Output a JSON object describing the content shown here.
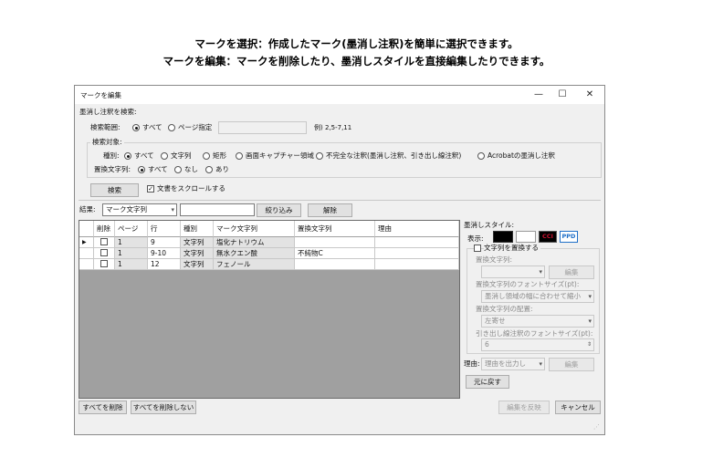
{
  "captions": [
    "マークを選択：作成したマーク(墨消し注釈)を簡単に選択できます。",
    "マークを編集：マークを削除したり、墨消しスタイルを直接編集したりできます。"
  ],
  "window": {
    "title": "マークを編集",
    "controls": {
      "minimize": "—",
      "maximize": "☐",
      "close": "✕"
    }
  },
  "search": {
    "section_label": "墨消し注釈を検索:",
    "range_label": "検索範囲:",
    "range_all": "すべて",
    "range_pages": "ページ指定",
    "range_input_value": "",
    "range_example": "例) 2,5-7,11",
    "target_label": "検索対象:",
    "type_label": "種別:",
    "types": [
      {
        "label": "すべて",
        "selected": true
      },
      {
        "label": "文字列",
        "selected": false
      },
      {
        "label": "矩形",
        "selected": false
      },
      {
        "label": "画面キャプチャー領域",
        "selected": false
      },
      {
        "label": "不完全な注釈(墨消し注釈、引き出し線注釈)",
        "selected": false
      },
      {
        "label": "Acrobatの墨消し注釈",
        "selected": false
      }
    ],
    "replace_label": "置換文字列:",
    "replace_options": [
      {
        "label": "すべて",
        "selected": true
      },
      {
        "label": "なし",
        "selected": false
      },
      {
        "label": "あり",
        "selected": false
      }
    ],
    "search_button": "検索",
    "scroll_checkbox": "文書をスクロールする",
    "scroll_checked": true
  },
  "results": {
    "label": "結果:",
    "filter_field": "マーク文字列",
    "filter_value": "",
    "narrow_button": "絞り込み",
    "clear_button": "解除",
    "columns": [
      "削除",
      "ページ",
      "行",
      "種別",
      "マーク文字列",
      "置換文字列",
      "理由"
    ],
    "rows": [
      {
        "delete": false,
        "page": "1",
        "line": "9",
        "type": "文字列",
        "mark": "塩化ナトリウム",
        "replace": "",
        "reason": "",
        "current": true
      },
      {
        "delete": false,
        "page": "1",
        "line": "9-10",
        "type": "文字列",
        "mark": "無水クエン酸",
        "replace": "不純物C",
        "reason": "",
        "current": false
      },
      {
        "delete": false,
        "page": "1",
        "line": "12",
        "type": "文字列",
        "mark": "フェノール",
        "replace": "",
        "reason": "",
        "current": false
      }
    ],
    "delete_all_button": "すべてを削除",
    "delete_none_button": "すべてを削除しない"
  },
  "style_panel": {
    "title": "墨消しスタイル:",
    "display_label": "表示:",
    "swatch_colors": [
      "#000000",
      "#ffffff"
    ],
    "badge_cci": "CCI",
    "badge_ppd": "PPD",
    "badge_cci_color": "#c8102e",
    "badge_ppd_color": "#1f6fc8",
    "replace_checkbox": "文字列を置換する",
    "replace_checked": false,
    "replace_text_label": "置換文字列:",
    "replace_text_value": "",
    "edit_button": "編集",
    "font_size_label": "置換文字列のフォントサイズ(pt):",
    "font_size_value": "墨消し領域の幅に合わせて縮小",
    "align_label": "置換文字列の配置:",
    "align_value": "左寄せ",
    "leader_font_label": "引き出し線注釈のフォントサイズ(pt):",
    "leader_font_value": "6",
    "reason_label": "理由:",
    "reason_value": "理由を出力し",
    "reason_edit_button": "編集",
    "reset_button": "元に戻す"
  },
  "footer": {
    "apply_button": "編集を反映",
    "cancel_button": "キャンセル"
  }
}
